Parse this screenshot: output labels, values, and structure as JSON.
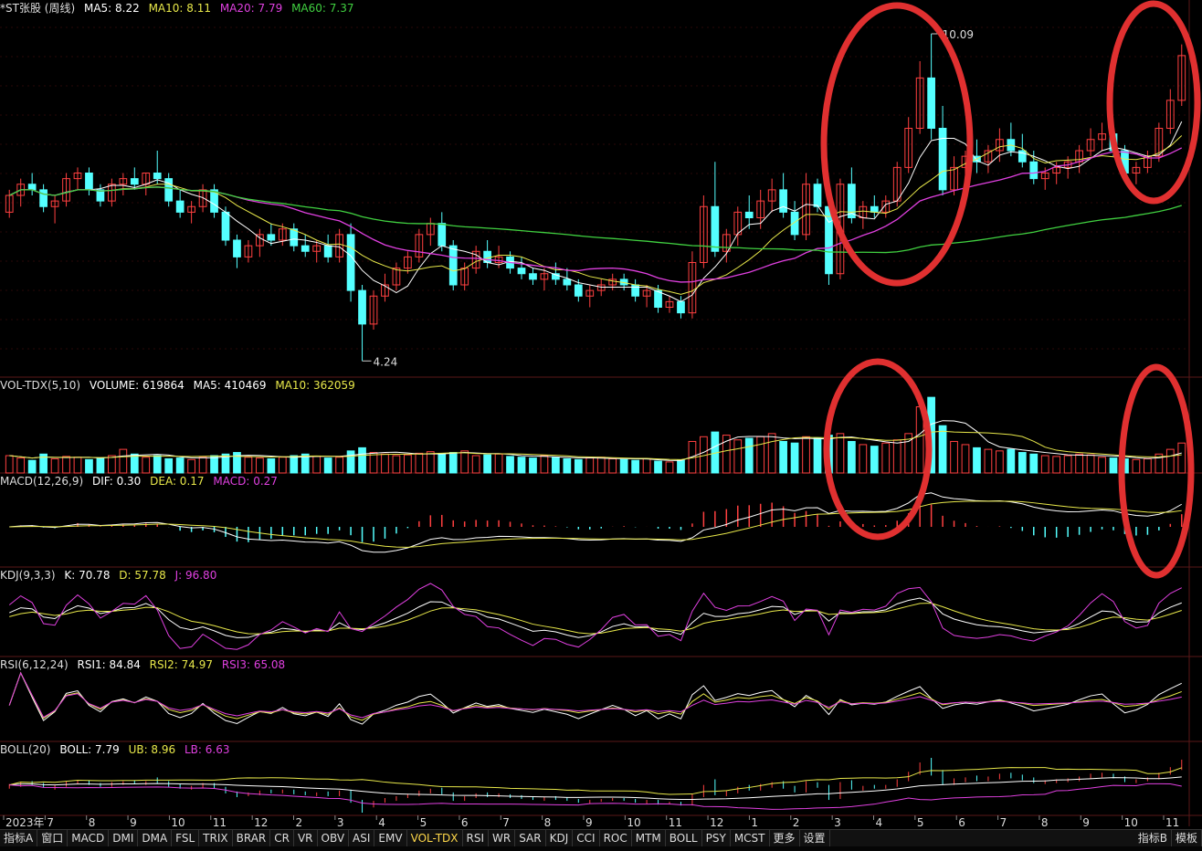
{
  "colors": {
    "up": "#ff4040",
    "down": "#54ffff",
    "ma5": "#ffffff",
    "ma10": "#e8e84a",
    "ma20": "#e040e0",
    "ma60": "#40d040",
    "grid": "#4a1010",
    "circle": "#e03030"
  },
  "panels": {
    "price": {
      "title": "*ST张股 (周线)",
      "ma5": "MA5: 8.22",
      "ma10": "MA10: 8.11",
      "ma20": "MA20: 7.79",
      "ma60": "MA60: 7.37",
      "high_label": "10.09",
      "low_label": "4.24"
    },
    "vol": {
      "title": "VOL-TDX(5,10)",
      "volume": "VOLUME: 619864",
      "ma5": "MA5: 410469",
      "ma10": "MA10: 362059"
    },
    "macd": {
      "title": "MACD(12,26,9)",
      "dif": "DIF: 0.30",
      "dea": "DEA: 0.17",
      "macd": "MACD: 0.27"
    },
    "kdj": {
      "title": "KDJ(9,3,3)",
      "k": "K: 70.78",
      "d": "D: 57.78",
      "j": "J: 96.80"
    },
    "rsi": {
      "title": "RSI(6,12,24)",
      "rsi1": "RSI1: 84.84",
      "rsi2": "RSI2: 74.97",
      "rsi3": "RSI3: 65.08"
    },
    "boll": {
      "title": "BOLL(20)",
      "boll": "BOLL: 7.79",
      "ub": "UB: 8.96",
      "lb": "LB: 6.63"
    }
  },
  "x_axis_labels": [
    "2023年",
    "7",
    "8",
    "9",
    "10",
    "11",
    "12",
    "2",
    "3",
    "4",
    "5",
    "6",
    "7",
    "8",
    "9",
    "10",
    "11",
    "12",
    "1",
    "2",
    "3",
    "4",
    "5",
    "6",
    "7",
    "8",
    "9",
    "10",
    "11"
  ],
  "toolbar": {
    "tabs": [
      "指标A",
      "窗口",
      "MACD",
      "DMI",
      "DMA",
      "FSL",
      "TRIX",
      "BRAR",
      "CR",
      "VR",
      "OBV",
      "ASI",
      "EMV",
      "VOL-TDX",
      "RSI",
      "WR",
      "SAR",
      "KDJ",
      "CCI",
      "ROC",
      "MTM",
      "BOLL",
      "PSY",
      "MCST",
      "更多",
      "设置"
    ],
    "active": "VOL-TDX",
    "right_tabs": [
      "指标B",
      "模板"
    ]
  },
  "chart_data": {
    "type": "candlestick",
    "period": "weekly",
    "ylim": [
      4.0,
      10.4
    ],
    "ohlc": [
      [
        6.9,
        7.3,
        6.8,
        7.2
      ],
      [
        7.2,
        7.5,
        7.0,
        7.4
      ],
      [
        7.4,
        7.6,
        7.2,
        7.3
      ],
      [
        7.3,
        7.4,
        6.9,
        7.0
      ],
      [
        7.0,
        7.2,
        6.7,
        7.1
      ],
      [
        7.1,
        7.6,
        7.0,
        7.5
      ],
      [
        7.5,
        7.7,
        7.3,
        7.6
      ],
      [
        7.6,
        7.7,
        7.2,
        7.3
      ],
      [
        7.3,
        7.4,
        7.0,
        7.1
      ],
      [
        7.1,
        7.5,
        7.0,
        7.4
      ],
      [
        7.4,
        7.6,
        7.2,
        7.5
      ],
      [
        7.5,
        7.7,
        7.3,
        7.4
      ],
      [
        7.4,
        7.6,
        7.2,
        7.6
      ],
      [
        7.6,
        8.0,
        7.4,
        7.5
      ],
      [
        7.5,
        7.6,
        7.0,
        7.1
      ],
      [
        7.1,
        7.3,
        6.8,
        6.9
      ],
      [
        6.9,
        7.1,
        6.7,
        7.0
      ],
      [
        7.0,
        7.4,
        6.9,
        7.3
      ],
      [
        7.3,
        7.4,
        6.8,
        6.9
      ],
      [
        6.9,
        7.0,
        6.3,
        6.4
      ],
      [
        6.4,
        6.5,
        5.9,
        6.1
      ],
      [
        6.1,
        6.4,
        6.0,
        6.3
      ],
      [
        6.3,
        6.6,
        6.1,
        6.5
      ],
      [
        6.5,
        6.7,
        6.3,
        6.4
      ],
      [
        6.4,
        6.7,
        6.3,
        6.6
      ],
      [
        6.6,
        6.7,
        6.2,
        6.3
      ],
      [
        6.3,
        6.5,
        6.1,
        6.2
      ],
      [
        6.2,
        6.4,
        6.0,
        6.3
      ],
      [
        6.3,
        6.5,
        6.0,
        6.1
      ],
      [
        6.1,
        6.6,
        6.0,
        6.5
      ],
      [
        6.5,
        6.7,
        5.3,
        5.5
      ],
      [
        5.5,
        5.6,
        4.24,
        4.9
      ],
      [
        4.9,
        5.5,
        4.8,
        5.4
      ],
      [
        5.4,
        5.8,
        5.3,
        5.6
      ],
      [
        5.6,
        6.0,
        5.5,
        5.9
      ],
      [
        5.9,
        6.2,
        5.8,
        6.1
      ],
      [
        6.1,
        6.6,
        6.0,
        6.5
      ],
      [
        6.5,
        6.8,
        6.3,
        6.7
      ],
      [
        6.7,
        6.9,
        6.2,
        6.3
      ],
      [
        6.3,
        6.4,
        5.5,
        5.6
      ],
      [
        5.6,
        6.0,
        5.5,
        5.9
      ],
      [
        5.9,
        6.3,
        5.8,
        6.2
      ],
      [
        6.2,
        6.4,
        5.9,
        6.0
      ],
      [
        6.0,
        6.3,
        5.9,
        6.1
      ],
      [
        6.1,
        6.2,
        5.8,
        5.9
      ],
      [
        5.9,
        6.1,
        5.7,
        5.8
      ],
      [
        5.8,
        5.9,
        5.6,
        5.7
      ],
      [
        5.7,
        5.9,
        5.5,
        5.8
      ],
      [
        5.8,
        6.0,
        5.6,
        5.7
      ],
      [
        5.7,
        5.9,
        5.5,
        5.6
      ],
      [
        5.6,
        5.7,
        5.3,
        5.4
      ],
      [
        5.4,
        5.6,
        5.2,
        5.5
      ],
      [
        5.5,
        5.7,
        5.4,
        5.6
      ],
      [
        5.6,
        5.8,
        5.5,
        5.7
      ],
      [
        5.7,
        5.8,
        5.5,
        5.6
      ],
      [
        5.6,
        5.7,
        5.3,
        5.4
      ],
      [
        5.4,
        5.6,
        5.2,
        5.5
      ],
      [
        5.5,
        5.6,
        5.1,
        5.2
      ],
      [
        5.2,
        5.4,
        5.1,
        5.3
      ],
      [
        5.3,
        5.4,
        5.0,
        5.1
      ],
      [
        5.1,
        6.2,
        5.0,
        6.0
      ],
      [
        6.0,
        7.2,
        5.9,
        7.0
      ],
      [
        7.0,
        7.8,
        6.1,
        6.2
      ],
      [
        6.2,
        6.6,
        6.0,
        6.5
      ],
      [
        6.5,
        7.0,
        6.3,
        6.9
      ],
      [
        6.9,
        7.2,
        6.6,
        6.8
      ],
      [
        6.8,
        7.3,
        6.6,
        7.1
      ],
      [
        7.1,
        7.5,
        6.9,
        7.3
      ],
      [
        7.3,
        7.6,
        6.8,
        6.9
      ],
      [
        6.9,
        7.1,
        6.4,
        6.5
      ],
      [
        6.5,
        7.6,
        6.4,
        7.4
      ],
      [
        7.4,
        7.5,
        6.9,
        7.0
      ],
      [
        7.0,
        7.2,
        5.6,
        5.8
      ],
      [
        5.8,
        7.5,
        5.7,
        7.4
      ],
      [
        7.4,
        7.7,
        6.7,
        6.8
      ],
      [
        6.8,
        7.1,
        6.6,
        7.0
      ],
      [
        7.0,
        7.2,
        6.8,
        6.9
      ],
      [
        6.9,
        7.2,
        6.8,
        7.1
      ],
      [
        7.1,
        7.8,
        7.0,
        7.7
      ],
      [
        7.7,
        8.6,
        7.6,
        8.4
      ],
      [
        8.4,
        9.6,
        8.3,
        9.3
      ],
      [
        9.3,
        10.09,
        8.2,
        8.4
      ],
      [
        8.4,
        8.8,
        7.2,
        7.3
      ],
      [
        7.3,
        7.9,
        7.2,
        7.7
      ],
      [
        7.7,
        8.0,
        7.5,
        7.9
      ],
      [
        7.9,
        8.2,
        7.6,
        7.8
      ],
      [
        7.8,
        8.1,
        7.6,
        8.0
      ],
      [
        8.0,
        8.4,
        7.8,
        8.2
      ],
      [
        8.2,
        8.5,
        7.9,
        8.0
      ],
      [
        8.0,
        8.3,
        7.7,
        7.8
      ],
      [
        7.8,
        8.0,
        7.4,
        7.5
      ],
      [
        7.5,
        7.7,
        7.3,
        7.6
      ],
      [
        7.6,
        7.8,
        7.4,
        7.7
      ],
      [
        7.7,
        7.9,
        7.5,
        7.8
      ],
      [
        7.8,
        8.1,
        7.6,
        8.0
      ],
      [
        8.0,
        8.4,
        7.9,
        8.2
      ],
      [
        8.2,
        8.5,
        8.0,
        8.3
      ],
      [
        8.3,
        8.4,
        7.9,
        8.0
      ],
      [
        8.0,
        8.1,
        7.5,
        7.6
      ],
      [
        7.6,
        7.8,
        7.4,
        7.7
      ],
      [
        7.7,
        8.0,
        7.6,
        7.9
      ],
      [
        7.9,
        8.5,
        7.8,
        8.4
      ],
      [
        8.4,
        9.1,
        8.3,
        8.9
      ],
      [
        8.9,
        9.9,
        8.8,
        9.7
      ]
    ],
    "volume": [
      110,
      95,
      80,
      120,
      90,
      105,
      100,
      85,
      95,
      110,
      150,
      120,
      100,
      110,
      90,
      95,
      85,
      100,
      110,
      120,
      130,
      100,
      95,
      90,
      100,
      110,
      120,
      105,
      95,
      100,
      140,
      160,
      130,
      120,
      110,
      115,
      125,
      135,
      120,
      130,
      140,
      110,
      115,
      120,
      105,
      100,
      95,
      110,
      100,
      90,
      85,
      95,
      100,
      90,
      85,
      80,
      90,
      75,
      70,
      80,
      200,
      230,
      260,
      240,
      210,
      220,
      230,
      250,
      200,
      190,
      230,
      220,
      240,
      250,
      200,
      180,
      170,
      190,
      210,
      250,
      420,
      480,
      300,
      200,
      180,
      160,
      150,
      140,
      150,
      130,
      120,
      110,
      105,
      110,
      120,
      115,
      100,
      95,
      90,
      85,
      90,
      120,
      150,
      190
    ],
    "annotations": [
      "10.09",
      "4.24"
    ]
  }
}
